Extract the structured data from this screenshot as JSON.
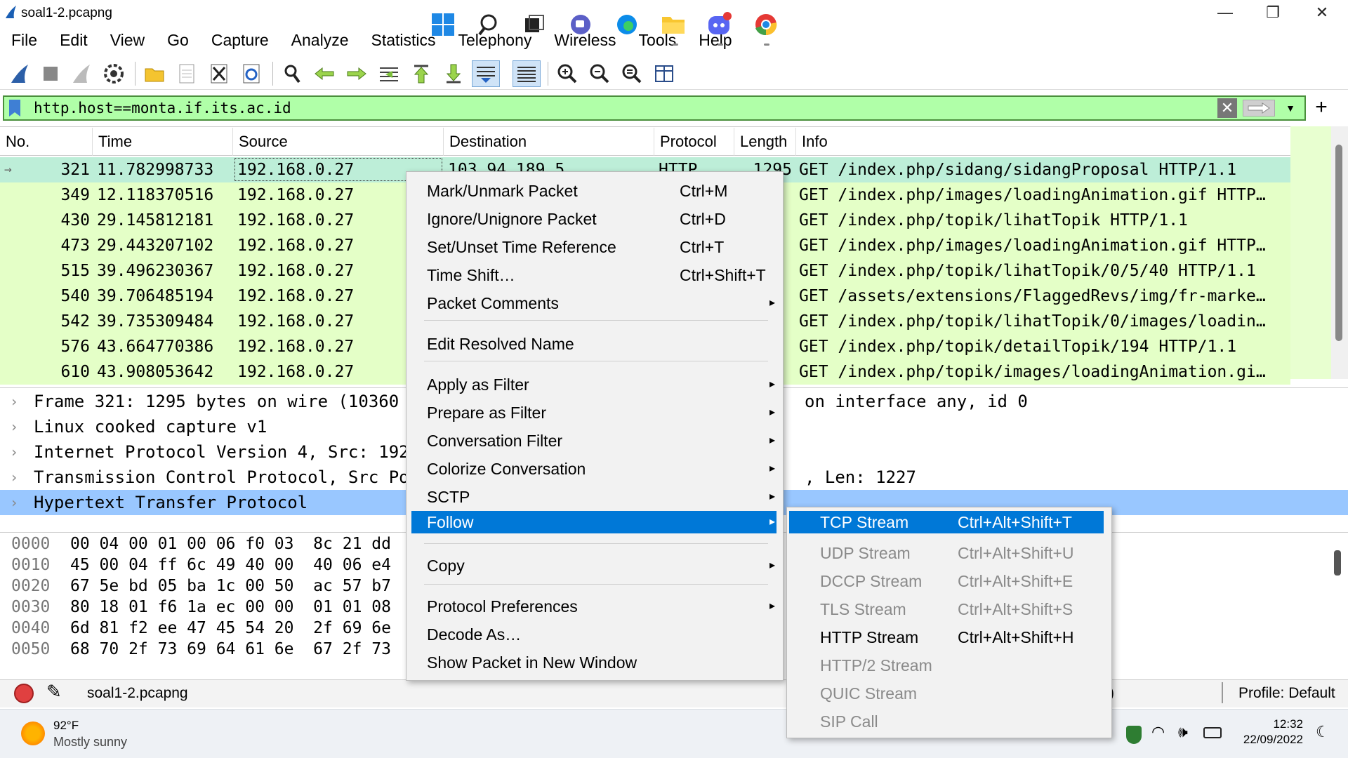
{
  "window": {
    "title": "soal1-2.pcapng",
    "minimize": "—",
    "maximize": "❐",
    "close": "✕"
  },
  "menu": [
    "File",
    "Edit",
    "View",
    "Go",
    "Capture",
    "Analyze",
    "Statistics",
    "Telephony",
    "Wireless",
    "Tools",
    "Help"
  ],
  "toolbar_icons": [
    "shark-fin-start-icon",
    "stop-capture-icon",
    "restart-capture-icon",
    "capture-options-icon",
    "open-file-icon",
    "save-file-icon",
    "close-file-icon",
    "reload-file-icon",
    "find-packet-icon",
    "go-back-icon",
    "go-forward-icon",
    "go-to-packet-icon",
    "first-packet-icon",
    "last-packet-icon",
    "autoscroll-icon",
    "colorize-icon",
    "zoom-in-icon",
    "zoom-out-icon",
    "zoom-normal-icon",
    "resize-columns-icon"
  ],
  "filter": {
    "value": "http.host==monta.if.its.ac.id"
  },
  "packet_list": {
    "columns": [
      "No.",
      "Time",
      "Source",
      "Destination",
      "Protocol",
      "Length",
      "Info"
    ],
    "rows": [
      {
        "no": "321",
        "time": "11.782998733",
        "src": "192.168.0.27",
        "dst": "103.94.189.5",
        "proto": "HTTP",
        "len": "1295",
        "info": "GET /index.php/sidang/sidangProposal HTTP/1.1"
      },
      {
        "no": "349",
        "time": "12.118370516",
        "src": "192.168.0.27",
        "dst": "",
        "proto": "",
        "len": "",
        "info": "GET /index.php/images/loadingAnimation.gif HTTP…"
      },
      {
        "no": "430",
        "time": "29.145812181",
        "src": "192.168.0.27",
        "dst": "",
        "proto": "",
        "len": "",
        "info": "GET /index.php/topik/lihatTopik HTTP/1.1"
      },
      {
        "no": "473",
        "time": "29.443207102",
        "src": "192.168.0.27",
        "dst": "",
        "proto": "",
        "len": "",
        "info": "GET /index.php/images/loadingAnimation.gif HTTP…"
      },
      {
        "no": "515",
        "time": "39.496230367",
        "src": "192.168.0.27",
        "dst": "",
        "proto": "",
        "len": "",
        "info": "GET /index.php/topik/lihatTopik/0/5/40 HTTP/1.1"
      },
      {
        "no": "540",
        "time": "39.706485194",
        "src": "192.168.0.27",
        "dst": "",
        "proto": "",
        "len": "",
        "info": "GET /assets/extensions/FlaggedRevs/img/fr-marke…"
      },
      {
        "no": "542",
        "time": "39.735309484",
        "src": "192.168.0.27",
        "dst": "",
        "proto": "",
        "len": "",
        "info": "GET /index.php/topik/lihatTopik/0/images/loadin…"
      },
      {
        "no": "576",
        "time": "43.664770386",
        "src": "192.168.0.27",
        "dst": "",
        "proto": "",
        "len": "",
        "info": "GET /index.php/topik/detailTopik/194 HTTP/1.1"
      },
      {
        "no": "610",
        "time": "43.908053642",
        "src": "192.168.0.27",
        "dst": "",
        "proto": "",
        "len": "",
        "info": "GET /index.php/topik/images/loadingAnimation.gi…"
      }
    ]
  },
  "details": [
    {
      "text": "Frame 321: 1295 bytes on wire (10360",
      "tail": "on interface any, id 0"
    },
    {
      "text": "Linux cooked capture v1",
      "tail": ""
    },
    {
      "text": "Internet Protocol Version 4, Src: 192",
      "tail": ""
    },
    {
      "text": "Transmission Control Protocol, Src Po",
      "tail": ", Len: 1227"
    },
    {
      "text": "Hypertext Transfer Protocol",
      "tail": ""
    }
  ],
  "bytes": [
    {
      "off": "0000",
      "hex": "00 04 00 01 00 06 f0 03  8c 21 dd"
    },
    {
      "off": "0010",
      "hex": "45 00 04 ff 6c 49 40 00  40 06 e4"
    },
    {
      "off": "0020",
      "hex": "67 5e bd 05 ba 1c 00 50  ac 57 b7"
    },
    {
      "off": "0030",
      "hex": "80 18 01 f6 1a ec 00 00  01 01 08"
    },
    {
      "off": "0040",
      "hex": "6d 81 f2 ee 47 45 54 20  2f 69 6e"
    },
    {
      "off": "0050",
      "hex": "68 70 2f 73 69 64 61 6e  67 2f 73"
    }
  ],
  "status": {
    "file": "soal1-2.pcapng",
    "partial": ")",
    "profile": "Profile: Default"
  },
  "context_menu": [
    {
      "label": "Mark/Unmark Packet",
      "shortcut": "Ctrl+M",
      "arrow": ""
    },
    {
      "label": "Ignore/Unignore Packet",
      "shortcut": "Ctrl+D",
      "arrow": ""
    },
    {
      "label": "Set/Unset Time Reference",
      "shortcut": "Ctrl+T",
      "arrow": ""
    },
    {
      "label": "Time Shift…",
      "shortcut": "Ctrl+Shift+T",
      "arrow": ""
    },
    {
      "label": "Packet Comments",
      "shortcut": "",
      "arrow": "▸"
    },
    {
      "label": "Edit Resolved Name",
      "shortcut": "",
      "arrow": ""
    },
    {
      "label": "Apply as Filter",
      "shortcut": "",
      "arrow": "▸"
    },
    {
      "label": "Prepare as Filter",
      "shortcut": "",
      "arrow": "▸"
    },
    {
      "label": "Conversation Filter",
      "shortcut": "",
      "arrow": "▸"
    },
    {
      "label": "Colorize Conversation",
      "shortcut": "",
      "arrow": "▸"
    },
    {
      "label": "SCTP",
      "shortcut": "",
      "arrow": "▸"
    },
    {
      "label": "Follow",
      "shortcut": "",
      "arrow": "▸"
    },
    {
      "label": "Copy",
      "shortcut": "",
      "arrow": "▸"
    },
    {
      "label": "Protocol Preferences",
      "shortcut": "",
      "arrow": "▸"
    },
    {
      "label": "Decode As…",
      "shortcut": "",
      "arrow": ""
    },
    {
      "label": "Show Packet in New Window",
      "shortcut": "",
      "arrow": ""
    }
  ],
  "follow_submenu": [
    {
      "label": "TCP Stream",
      "shortcut": "Ctrl+Alt+Shift+T"
    },
    {
      "label": "UDP Stream",
      "shortcut": "Ctrl+Alt+Shift+U"
    },
    {
      "label": "DCCP Stream",
      "shortcut": "Ctrl+Alt+Shift+E"
    },
    {
      "label": "TLS Stream",
      "shortcut": "Ctrl+Alt+Shift+S"
    },
    {
      "label": "HTTP Stream",
      "shortcut": "Ctrl+Alt+Shift+H"
    },
    {
      "label": "HTTP/2 Stream",
      "shortcut": ""
    },
    {
      "label": "QUIC Stream",
      "shortcut": ""
    },
    {
      "label": "SIP Call",
      "shortcut": ""
    }
  ],
  "taskbar": {
    "weather_temp": "92°F",
    "weather_desc": "Mostly sunny",
    "time": "12:32",
    "date": "22/09/2022",
    "apps": [
      "windows-start-icon",
      "search-icon",
      "task-view-icon",
      "teams-chat-icon",
      "edge-icon",
      "file-explorer-icon",
      "discord-icon",
      "chrome-icon"
    ]
  },
  "colors": {
    "filter_valid": "#b0ffa8",
    "packet_row": "#e4ffc7",
    "selected_row": "#bdeed8",
    "menu_highlight": "#0078d7",
    "details_selected": "#99c7ff"
  }
}
